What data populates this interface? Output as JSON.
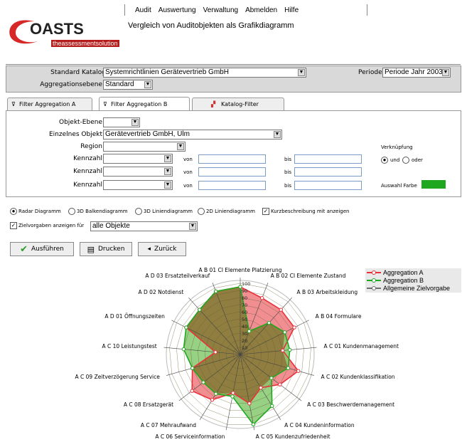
{
  "menu": [
    "Audit",
    "Auswertung",
    "Verwaltung",
    "Abmelden",
    "Hilfe"
  ],
  "logo": {
    "text": "OASTS",
    "c": "C",
    "tagline": "theassessmentsolution"
  },
  "page_title": "Vergleich von Auditobjekten als Grafikdiagramm",
  "top_panel": {
    "catalog_label": "Standard Katalog",
    "catalog_value": "Systemrichtlinien Gerätevertrieb GmbH",
    "period_label": "Periode",
    "period_value": "Periode Jahr 2003",
    "level_label": "Aggregationsebene",
    "level_value": "Standard"
  },
  "tabs": [
    "Filter Aggregation A",
    "Filter Aggregation B",
    "Katalog-Filter"
  ],
  "filter": {
    "object_level_label": "Objekt-Ebene",
    "single_object_label": "Einzelnes Objekt",
    "single_object_value": "Gerätevertrieb GmbH, Ulm",
    "region_label": "Region",
    "kennzahl_label": "Kennzahl",
    "von_label": "von",
    "bis_label": "bis",
    "link_label": "Verknüpfung",
    "und_label": "und",
    "oder_label": "oder",
    "color_label": "Auswahl Farbe",
    "color_value": "#1fa81f"
  },
  "chart_options": {
    "radar": "Radar Diagramm",
    "bar3d": "3D Balkendiagramm",
    "line3d": "3D Liniendiagramm",
    "line2d": "2D Liniendiagramm",
    "short_desc": "Kurzbeschreibung mit anzeigen",
    "targets_label": "Zielvorgaben anzeigen für",
    "targets_value": "alle Objekte"
  },
  "buttons": {
    "run": "Ausführen",
    "print": "Drucken",
    "back": "Zurück"
  },
  "legend": [
    "Aggregation A",
    "Aggregation B",
    "Allgemeine Zielvorgabe"
  ],
  "colors": {
    "a": "#e8313a",
    "b": "#1fa81f",
    "target": "#6d6d6d",
    "fill_a": "#ef7a7f",
    "fill_b": "#84c96e",
    "overlap": "#8e7a3c"
  },
  "chart_data": {
    "type": "radar",
    "categories": [
      "A B  01 CI Elemente Platzierung",
      "A B  02 CI Elemente Zustand",
      "A B  03 Arbeitskleidung",
      "A B  04 Formulare",
      "A C  01 Kundenmanagement",
      "A C  02 Kundenklassifikation",
      "A C  03 Beschwerdemanagement",
      "A C  04 Kundeninformation",
      "A C  05 Kundenzufriedenheit",
      "A C  06 Serviceinformation",
      "A C  07 Mehraufwand",
      "A C  08 Ersatzgerät",
      "A C  09 Zeitverzögerung Service",
      "A C  10 Leistungstest",
      "A D  01 Öffnungszeiten",
      "A D  02 Notdienst",
      "A D  03 Ersatzteilverkauf"
    ],
    "ticks": [
      "10",
      "20",
      "30",
      "40",
      "50",
      "60",
      "70",
      "80",
      "90",
      "100"
    ],
    "rmax": 100,
    "series": [
      {
        "name": "Aggregation A",
        "values": [
          95,
          85,
          85,
          85,
          60,
          85,
          70,
          55,
          70,
          55,
          75,
          85,
          70,
          35,
          85,
          85,
          95
        ]
      },
      {
        "name": "Aggregation B",
        "values": [
          95,
          35,
          60,
          70,
          70,
          70,
          55,
          85,
          100,
          60,
          65,
          65,
          70,
          80,
          85,
          85,
          95
        ]
      },
      {
        "name": "Allgemeine Zielvorgabe",
        "values": [
          0,
          0,
          0,
          0,
          0,
          0,
          0,
          0,
          0,
          0,
          0,
          0,
          0,
          0,
          0,
          0,
          0
        ]
      }
    ]
  }
}
